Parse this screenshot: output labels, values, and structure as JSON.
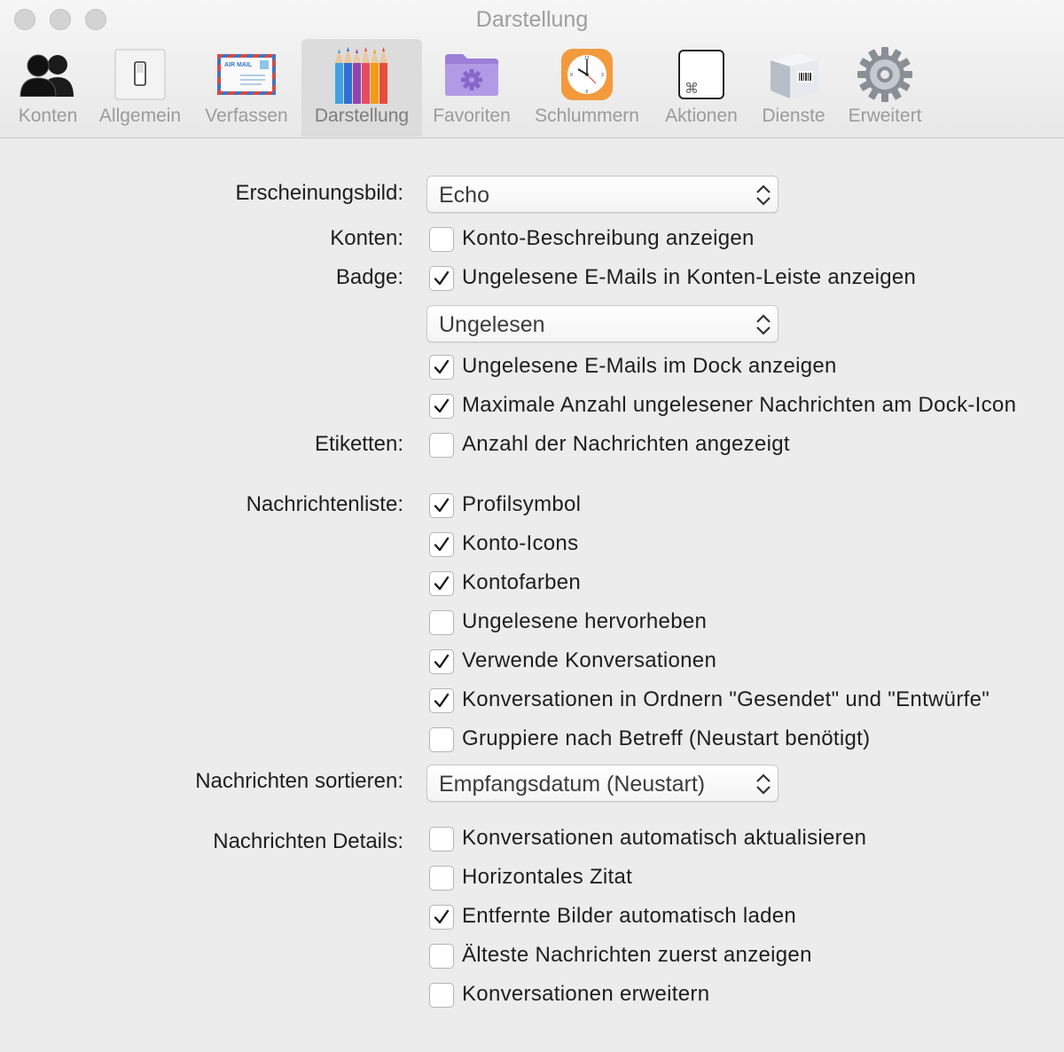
{
  "window": {
    "title": "Darstellung"
  },
  "toolbar": {
    "tabs": [
      {
        "label": "Konten",
        "icon": "accounts-icon"
      },
      {
        "label": "Allgemein",
        "icon": "switch-icon"
      },
      {
        "label": "Verfassen",
        "icon": "airmail-envelope-icon"
      },
      {
        "label": "Darstellung",
        "icon": "pencils-icon",
        "active": true
      },
      {
        "label": "Favoriten",
        "icon": "folder-gear-icon"
      },
      {
        "label": "Schlummern",
        "icon": "clock-icon"
      },
      {
        "label": "Aktionen",
        "icon": "command-key-icon"
      },
      {
        "label": "Dienste",
        "icon": "package-barcode-icon"
      },
      {
        "label": "Erweitert",
        "icon": "gear-icon"
      }
    ]
  },
  "form": {
    "appearance": {
      "label": "Erscheinungsbild:",
      "value": "Echo"
    },
    "accounts": {
      "label": "Konten:",
      "options": [
        {
          "text": "Konto-Beschreibung anzeigen",
          "checked": false
        }
      ]
    },
    "badge": {
      "label": "Badge:",
      "option_top": {
        "text": "Ungelesene E-Mails in Konten-Leiste anzeigen",
        "checked": true
      },
      "popup_value": "Ungelesen",
      "options": [
        {
          "text": "Ungelesene E-Mails im Dock anzeigen",
          "checked": true
        },
        {
          "text": "Maximale Anzahl ungelesener Nachrichten am Dock-Icon",
          "checked": true
        }
      ]
    },
    "labels": {
      "label": "Etiketten:",
      "options": [
        {
          "text": "Anzahl der Nachrichten angezeigt",
          "checked": false
        }
      ]
    },
    "message_list": {
      "label": "Nachrichtenliste:",
      "options": [
        {
          "text": "Profilsymbol",
          "checked": true
        },
        {
          "text": "Konto-Icons",
          "checked": true
        },
        {
          "text": "Kontofarben",
          "checked": true
        },
        {
          "text": "Ungelesene hervorheben",
          "checked": false
        },
        {
          "text": "Verwende Konversationen",
          "checked": true
        },
        {
          "text": "Konversationen in Ordnern \"Gesendet\" und \"Entwürfe\"",
          "checked": true
        },
        {
          "text": "Gruppiere nach Betreff (Neustart benötigt)",
          "checked": false
        }
      ]
    },
    "sort": {
      "label": "Nachrichten sortieren:",
      "value": "Empfangsdatum (Neustart)"
    },
    "details": {
      "label": "Nachrichten Details:",
      "options": [
        {
          "text": "Konversationen automatisch aktualisieren",
          "checked": false
        },
        {
          "text": "Horizontales Zitat",
          "checked": false
        },
        {
          "text": "Entfernte Bilder automatisch laden",
          "checked": true
        },
        {
          "text": "Älteste Nachrichten zuerst anzeigen",
          "checked": false
        },
        {
          "text": "Konversationen erweitern",
          "checked": false
        }
      ]
    }
  }
}
